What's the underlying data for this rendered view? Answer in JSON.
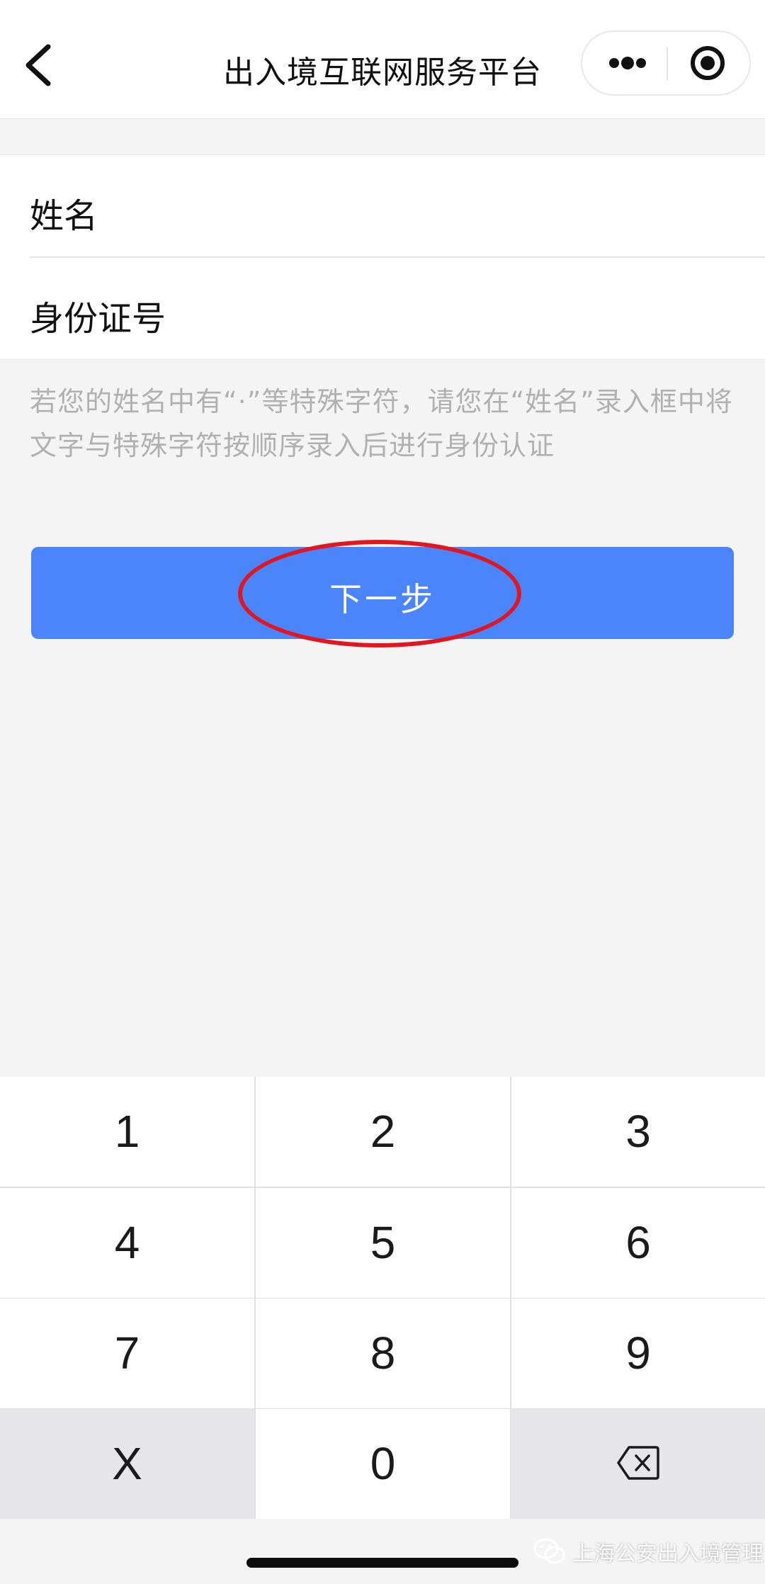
{
  "navbar": {
    "title": "出入境互联网服务平台",
    "back_icon": "chevron-left-icon",
    "more_icon": "more-dots-icon",
    "close_icon": "target-close-icon"
  },
  "form": {
    "name_label": "姓名",
    "name_value": "",
    "id_label": "身份证号",
    "id_value": ""
  },
  "hint": "若您的姓名中有“·”等特殊字符，请您在“姓名”录入框中将文字与特殊字符按顺序录入后进行身份认证",
  "next_button": {
    "label": "下一步",
    "color": "#4a85fc",
    "highlight_color": "#e3161f"
  },
  "keypad": {
    "keys": [
      "1",
      "2",
      "3",
      "4",
      "5",
      "6",
      "7",
      "8",
      "9",
      "X",
      "0"
    ],
    "delete_icon": "backspace-icon"
  },
  "watermark": {
    "text": "上海公安出入境管理",
    "icon": "wechat-icon"
  }
}
